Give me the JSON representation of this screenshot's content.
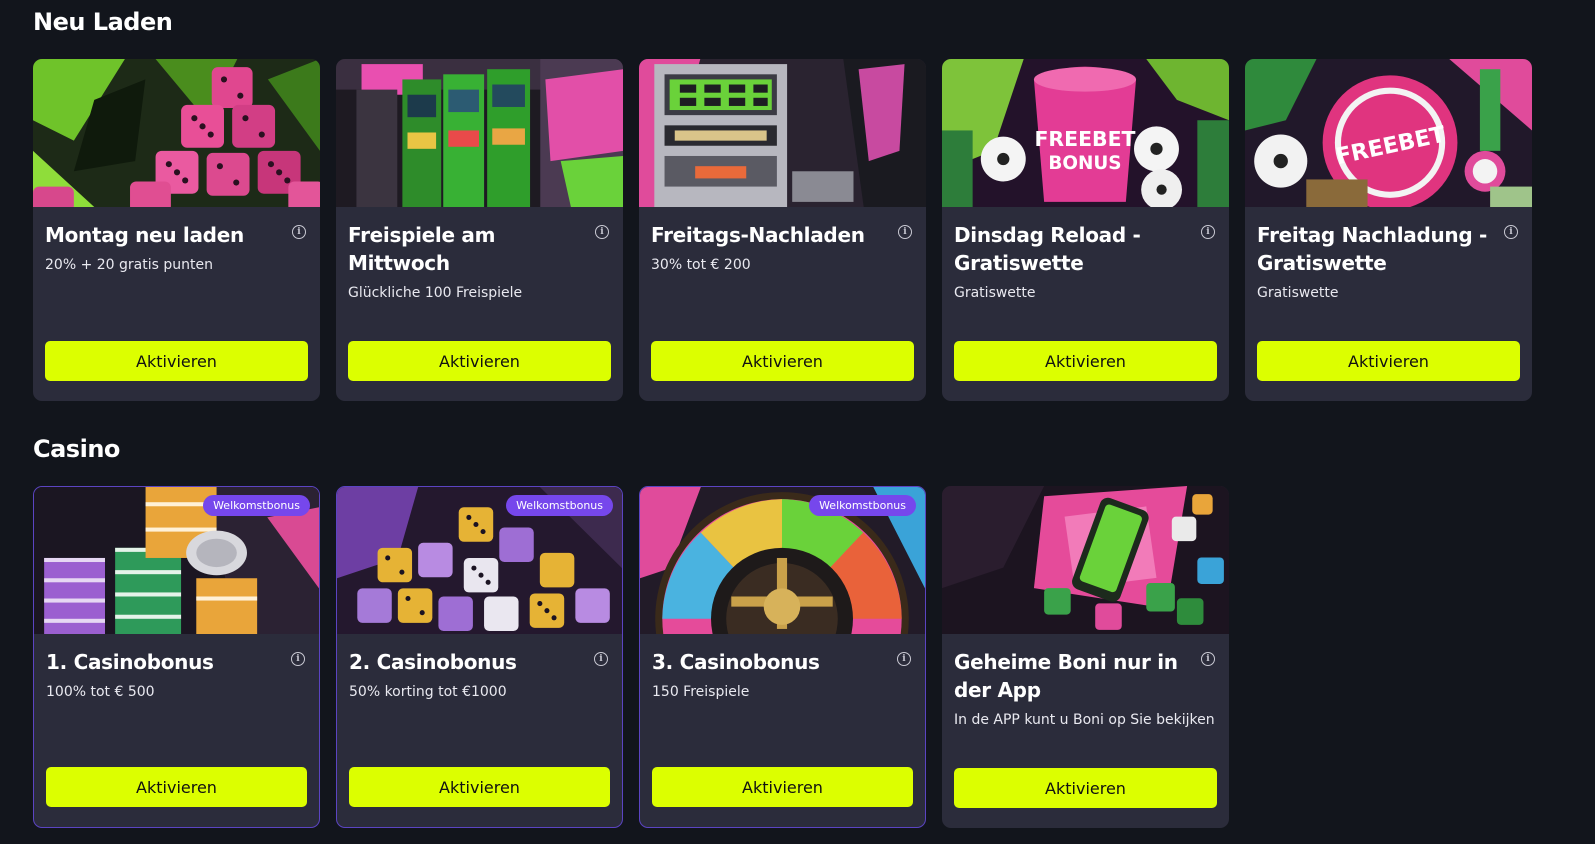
{
  "sections": {
    "reload": {
      "title": "Neu Laden",
      "cards": [
        {
          "title": "Montag neu laden",
          "desc": "20% + 20 gratis punten",
          "button": "Aktivieren"
        },
        {
          "title": "Freispiele am Mittwoch",
          "desc": "Glückliche 100 Freispiele",
          "button": "Aktivieren"
        },
        {
          "title": "Freitags-Nachladen",
          "desc": "30% tot € 200",
          "button": "Aktivieren"
        },
        {
          "title": "Dinsdag Reload - Gratiswette",
          "desc": "Gratiswette",
          "button": "Aktivieren",
          "image_text_1": "FREEBET",
          "image_text_2": "BONUS"
        },
        {
          "title": "Freitag Nachladung - Gratiswette",
          "desc": "Gratiswette",
          "button": "Aktivieren",
          "image_text": "FREEBET"
        }
      ]
    },
    "casino": {
      "title": "Casino",
      "cards": [
        {
          "title": "1. Casinobonus",
          "desc": "100% tot € 500",
          "button": "Aktivieren",
          "badge": "Welkomstbonus"
        },
        {
          "title": "2. Casinobonus",
          "desc": "50% korting tot €1000",
          "button": "Aktivieren",
          "badge": "Welkomstbonus"
        },
        {
          "title": "3. Casinobonus",
          "desc": "150 Freispiele",
          "button": "Aktivieren",
          "badge": "Welkomstbonus"
        },
        {
          "title": "Geheime Boni nur in der App",
          "desc": "In de APP kunt u Boni op Sie bekijken",
          "button": "Aktivieren"
        }
      ]
    }
  },
  "colors": {
    "background": "#12151c",
    "card": "#2b2c3b",
    "button": "#dcff00",
    "badge": "#7647ec",
    "welcome_border": "#5b44c2"
  },
  "icons": [
    "info-icon"
  ]
}
